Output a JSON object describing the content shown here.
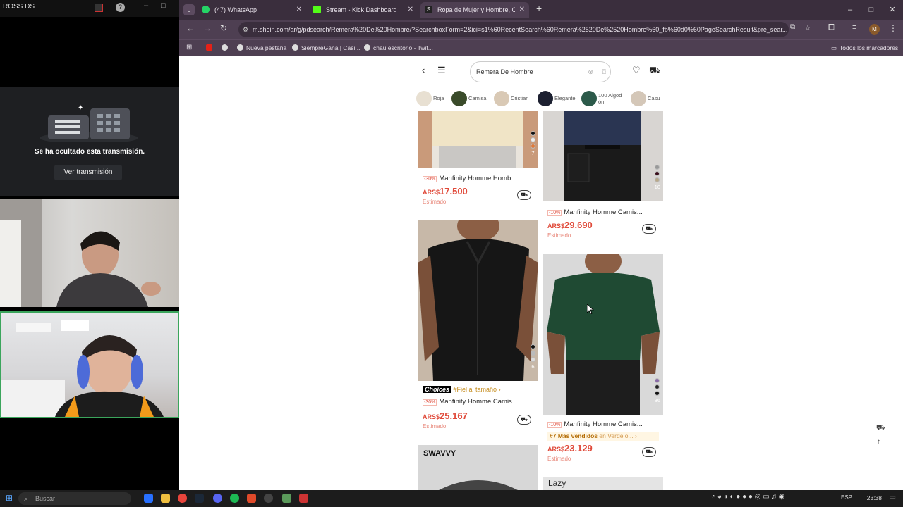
{
  "left_panel": {
    "title": "ROSS DS",
    "hidden_message": "Se ha ocultado esta transmisión.",
    "watch_button": "Ver transmisión"
  },
  "browser": {
    "tabs": [
      {
        "label": "(47) WhatsApp",
        "color": "#25d366"
      },
      {
        "label": "Stream - Kick Dashboard",
        "color": "#53fc18"
      },
      {
        "label": "Ropa de Mujer y Hombre, Con",
        "color": "#222222"
      }
    ],
    "new_tab": "+",
    "url": "m.shein.com/ar/g/pdsearch/Remera%20De%20Hombre/?SearchboxForm=2&ici=s1%60RecentSearch%60Remera%2520De%2520Hombre%60_fb%60d0%60PageSearchResult&pre_sear...",
    "bookmarks": [
      {
        "label": "Nueva pestaña"
      },
      {
        "label": "SiempreGana | Casi..."
      },
      {
        "label": "chau escritorio - Twit..."
      }
    ],
    "all_bookmarks": "Todos los marcadores"
  },
  "site": {
    "search_value": "Remera De Hombre",
    "chips": [
      "Roja",
      "Camisa",
      "Cristian",
      "Elegante",
      "100 Algod ón",
      "Casu"
    ],
    "products": [
      {
        "discount": "-30%",
        "title": "Manfinity Homme Homb",
        "currency": "ARS$",
        "price": "17.500",
        "estimate": "Estimado",
        "swatch_count": "7"
      },
      {
        "discount": "-10%",
        "title": "Manfinity Homme Camis...",
        "currency": "ARS$",
        "price": "29.690",
        "estimate": "Estimado",
        "swatch_count": "10"
      },
      {
        "choices": "Choices",
        "choices_tag": "#Fiel al tamaño ›",
        "discount": "-30%",
        "title": "Manfinity Homme Camis...",
        "currency": "ARS$",
        "price": "25.167",
        "estimate": "Estimado",
        "swatch_count": "6"
      },
      {
        "bestseller": "#7 Más vendidos",
        "bestseller_cat": "en Verde o... ›",
        "discount": "-10%",
        "title": "Manfinity Homme Camis...",
        "currency": "ARS$",
        "price": "23.129",
        "estimate": "Estimado",
        "swatch_count": "36"
      },
      {
        "brand": "SWAVVY"
      },
      {
        "brand": "Lazy"
      }
    ]
  },
  "taskbar": {
    "search_placeholder": "Buscar",
    "language": "ESP",
    "time": "23:38"
  }
}
